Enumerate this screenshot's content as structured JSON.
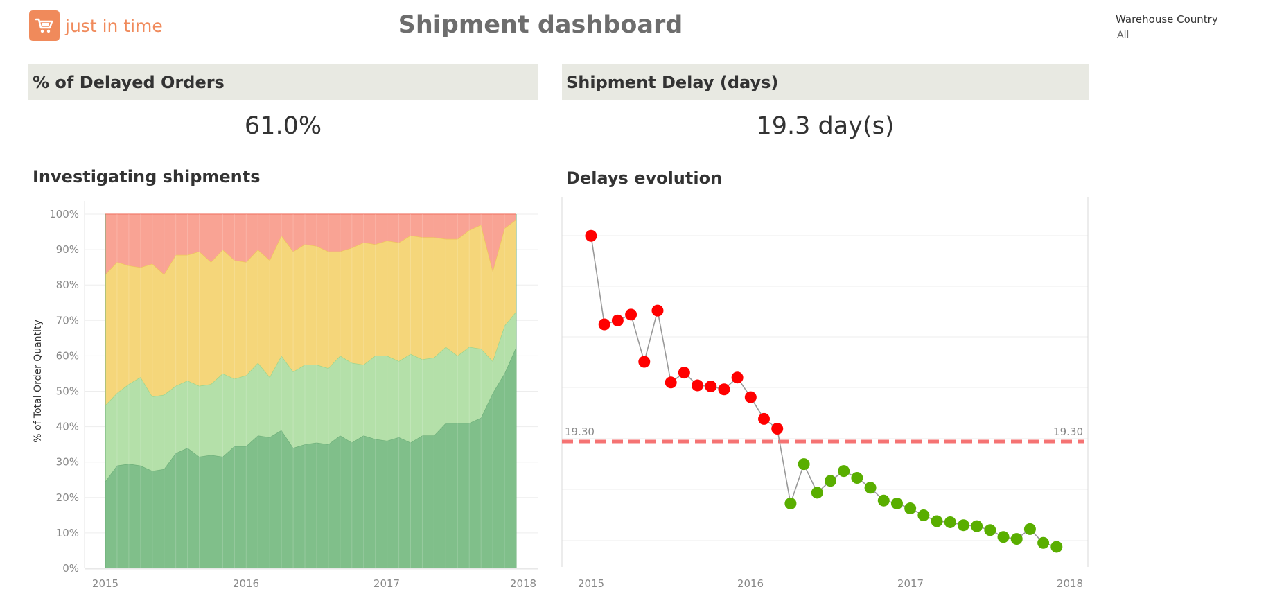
{
  "brand": {
    "logo_text": "just in time",
    "icon": "shopping-cart-icon"
  },
  "page": {
    "title": "Shipment dashboard"
  },
  "filter": {
    "label": "Warehouse Country",
    "value": "All"
  },
  "kpis": [
    {
      "title": "% of Delayed Orders",
      "value": "61.0%"
    },
    {
      "title": "Shipment Delay (days)",
      "value": "19.3 day(s)"
    }
  ],
  "sections": {
    "left_title": "Investigating shipments",
    "right_title": "Delays evolution"
  },
  "colors": {
    "band_red": "#f9a394",
    "band_red_line": "#f27d6e",
    "band_yellow": "#f5d67a",
    "band_yellow_line": "#eec45c",
    "band_lightgreen": "#b4e0a9",
    "band_lightgreen_line": "#98d48b",
    "band_green": "#80bf8a",
    "band_green_line": "#6cae78",
    "point_red": "#ff0000",
    "point_green": "#59ae00",
    "line_gray": "#999999",
    "ref_line": "#f57373"
  },
  "chart_data": [
    {
      "type": "area",
      "title": "Investigating shipments",
      "ylabel": "% of Total Order Quantity",
      "x_ticks": [
        "2015",
        "2016",
        "2017",
        "2018"
      ],
      "y_ticks": [
        "0%",
        "10%",
        "20%",
        "30%",
        "40%",
        "50%",
        "60%",
        "70%",
        "80%",
        "90%",
        "100%"
      ],
      "ylim": [
        0,
        100
      ],
      "x_range": [
        "2015-01",
        "2018-01"
      ],
      "x": [
        "2015-01",
        "2015-02",
        "2015-03",
        "2015-04",
        "2015-05",
        "2015-06",
        "2015-07",
        "2015-08",
        "2015-09",
        "2015-10",
        "2015-11",
        "2015-12",
        "2016-01",
        "2016-02",
        "2016-03",
        "2016-04",
        "2016-05",
        "2016-06",
        "2016-07",
        "2016-08",
        "2016-09",
        "2016-10",
        "2016-11",
        "2016-12",
        "2017-01",
        "2017-02",
        "2017-03",
        "2017-04",
        "2017-05",
        "2017-06",
        "2017-07",
        "2017-08",
        "2017-09",
        "2017-10",
        "2017-11",
        "2017-12"
      ],
      "series_stacked_tops": [
        {
          "values": [
            24.5,
            29,
            29.5,
            29,
            27.5,
            28,
            32.5,
            34,
            31.5,
            32,
            31.5,
            34.5,
            34.5,
            37.5,
            37,
            39,
            34,
            35,
            35.5,
            35,
            37.5,
            35.5,
            37.5,
            36.5,
            36,
            37,
            35.5,
            37.5,
            37.5,
            41,
            41,
            41,
            42.5,
            49.5,
            55,
            62.5
          ]
        },
        {
          "values": [
            46,
            49.5,
            52,
            54,
            48.5,
            49,
            51.5,
            53,
            51.5,
            52,
            55,
            53.5,
            54.5,
            58,
            54,
            60,
            55.5,
            57.5,
            57.5,
            56.5,
            60,
            58,
            57.5,
            60,
            60,
            58.5,
            60.5,
            59,
            59.5,
            62.5,
            60,
            62.5,
            62,
            58.5,
            68.5,
            72.5
          ]
        },
        {
          "values": [
            83,
            86.5,
            85.5,
            85,
            86,
            83,
            88.5,
            88.5,
            89.5,
            86.5,
            90,
            87,
            86.5,
            90,
            87,
            94,
            89.5,
            91.5,
            91,
            89.5,
            89.5,
            90.5,
            92,
            91.5,
            92.5,
            92,
            94,
            93.5,
            93.5,
            93,
            93,
            95.5,
            97,
            84,
            96,
            98.5
          ]
        },
        {
          "values": [
            100,
            100,
            100,
            100,
            100,
            100,
            100,
            100,
            100,
            100,
            100,
            100,
            100,
            100,
            100,
            100,
            100,
            100,
            100,
            100,
            100,
            100,
            100,
            100,
            100,
            100,
            100,
            100,
            100,
            100,
            100,
            100,
            100,
            100,
            100,
            100
          ]
        }
      ]
    },
    {
      "type": "line",
      "title": "Delays evolution",
      "x_ticks": [
        "2015",
        "2016",
        "2017",
        "2018"
      ],
      "x_range": [
        "2015-01",
        "2018-01"
      ],
      "reference_line": {
        "value": 19.3,
        "left_label": "19.30",
        "right_label": "19.30"
      },
      "points": [
        {
          "x": "2015-01",
          "y": 40.2,
          "status": "red"
        },
        {
          "x": "2015-02",
          "y": 31.2,
          "status": "red"
        },
        {
          "x": "2015-03",
          "y": 31.6,
          "status": "red"
        },
        {
          "x": "2015-04",
          "y": 32.2,
          "status": "red"
        },
        {
          "x": "2015-05",
          "y": 27.4,
          "status": "red"
        },
        {
          "x": "2015-06",
          "y": 32.6,
          "status": "red"
        },
        {
          "x": "2015-07",
          "y": 25.3,
          "status": "red"
        },
        {
          "x": "2015-08",
          "y": 26.3,
          "status": "red"
        },
        {
          "x": "2015-09",
          "y": 25.0,
          "status": "red"
        },
        {
          "x": "2015-10",
          "y": 24.9,
          "status": "red"
        },
        {
          "x": "2015-11",
          "y": 24.6,
          "status": "red"
        },
        {
          "x": "2015-12",
          "y": 25.8,
          "status": "red"
        },
        {
          "x": "2016-01",
          "y": 23.8,
          "status": "red"
        },
        {
          "x": "2016-02",
          "y": 21.6,
          "status": "red"
        },
        {
          "x": "2016-03",
          "y": 20.6,
          "status": "red"
        },
        {
          "x": "2016-04",
          "y": 13.0,
          "status": "green"
        },
        {
          "x": "2016-05",
          "y": 17.0,
          "status": "green"
        },
        {
          "x": "2016-06",
          "y": 14.1,
          "status": "green"
        },
        {
          "x": "2016-07",
          "y": 15.3,
          "status": "green"
        },
        {
          "x": "2016-08",
          "y": 16.3,
          "status": "green"
        },
        {
          "x": "2016-09",
          "y": 15.6,
          "status": "green"
        },
        {
          "x": "2016-10",
          "y": 14.6,
          "status": "green"
        },
        {
          "x": "2016-11",
          "y": 13.3,
          "status": "green"
        },
        {
          "x": "2016-12",
          "y": 13.0,
          "status": "green"
        },
        {
          "x": "2017-01",
          "y": 12.5,
          "status": "green"
        },
        {
          "x": "2017-02",
          "y": 11.8,
          "status": "green"
        },
        {
          "x": "2017-03",
          "y": 11.2,
          "status": "green"
        },
        {
          "x": "2017-04",
          "y": 11.1,
          "status": "green"
        },
        {
          "x": "2017-05",
          "y": 10.8,
          "status": "green"
        },
        {
          "x": "2017-06",
          "y": 10.7,
          "status": "green"
        },
        {
          "x": "2017-07",
          "y": 10.3,
          "status": "green"
        },
        {
          "x": "2017-08",
          "y": 9.6,
          "status": "green"
        },
        {
          "x": "2017-09",
          "y": 9.4,
          "status": "green"
        },
        {
          "x": "2017-10",
          "y": 10.4,
          "status": "green"
        },
        {
          "x": "2017-11",
          "y": 9.0,
          "status": "green"
        },
        {
          "x": "2017-12",
          "y": 8.6,
          "status": "green"
        }
      ]
    }
  ]
}
